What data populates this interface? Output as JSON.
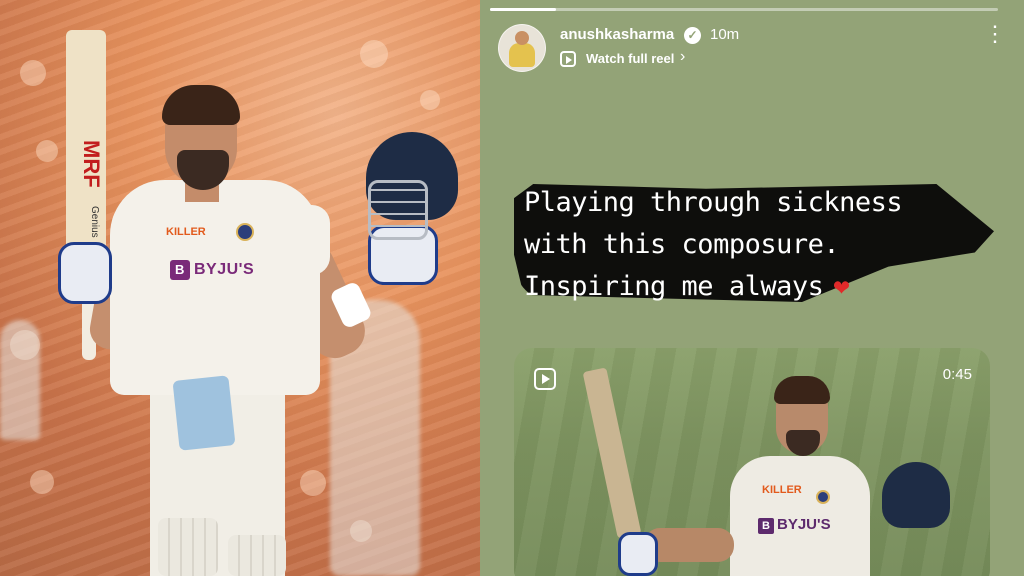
{
  "photo": {
    "bat_brand": "MRF",
    "bat_model": "Genius",
    "shirt_kit": "KILLER",
    "shirt_sponsor": "BYJU'S",
    "sponsor_logo_letter": "B"
  },
  "story": {
    "username": "anushkasharma",
    "verified_glyph": "✓",
    "time_ago": "10m",
    "reel_link": "Watch full reel",
    "reel_chevron": "›",
    "more_glyph": "⋮",
    "caption_lines": [
      "Playing through sickness",
      "with this composure.",
      "Inspiring me always"
    ],
    "caption_emoji": "❤",
    "progress_fraction": 0.13,
    "video": {
      "duration": "0:45",
      "sponsor": "BYJU'S",
      "sponsor_logo_letter": "B",
      "kit": "KILLER"
    },
    "icons": {
      "verified": "verified-badge-icon",
      "reel": "reel-icon",
      "more": "more-options-icon",
      "heart": "red-heart-emoji"
    },
    "colors": {
      "background": "#93a377",
      "brush_stroke": "#0e0e0c",
      "heart": "#e02a2a",
      "text": "#ffffff"
    }
  }
}
